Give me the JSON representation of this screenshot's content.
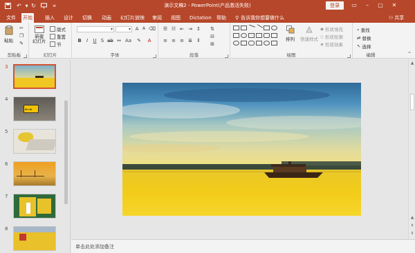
{
  "titlebar": {
    "title": "演示文稿2  -  PowerPoint(产品激活失败)",
    "login": "登录",
    "icons": [
      "save-icon",
      "undo-icon",
      "redo-icon",
      "present-icon",
      "customize-icon"
    ]
  },
  "tabs": [
    {
      "label": "文件"
    },
    {
      "label": "开始",
      "active": true
    },
    {
      "label": "插入"
    },
    {
      "label": "设计"
    },
    {
      "label": "切换"
    },
    {
      "label": "动画"
    },
    {
      "label": "幻灯片放映"
    },
    {
      "label": "审阅"
    },
    {
      "label": "视图"
    },
    {
      "label": "Dictation"
    },
    {
      "label": "帮助"
    }
  ],
  "tellme": "告诉我你想要做什么",
  "share": "共享",
  "ribbon": {
    "clipboard": {
      "label": "剪贴板",
      "paste": "粘贴"
    },
    "slides": {
      "label": "幻灯片",
      "new_slide": "新建\n幻灯片",
      "layout": "版式",
      "reset": "重置",
      "section": "节"
    },
    "font": {
      "label": "字体",
      "font_value": "",
      "size_value": ""
    },
    "paragraph": {
      "label": "段落"
    },
    "drawing": {
      "label": "绘图",
      "arrange": "排列",
      "quick_styles": "快速样式",
      "fill": "形状填充",
      "outline": "形状轮廓",
      "effects": "形状效果"
    },
    "editing": {
      "label": "编辑",
      "find": "查找",
      "replace": "替换",
      "select": "选择"
    }
  },
  "slides_panel": [
    {
      "number": "3",
      "active": true
    },
    {
      "number": "4"
    },
    {
      "number": "5"
    },
    {
      "number": "6"
    },
    {
      "number": "7"
    },
    {
      "number": "8"
    }
  ],
  "notes_placeholder": "单击此处添加备注",
  "colors": {
    "accent": "#b7472a",
    "ribbon_bg": "#f3f3f3",
    "workspace": "#e6e6e6"
  }
}
